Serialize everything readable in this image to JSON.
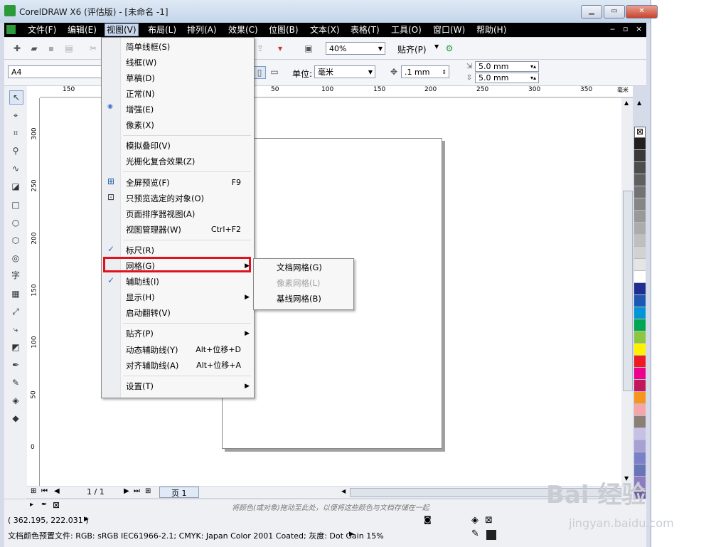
{
  "window": {
    "title": "CorelDRAW X6 (评估版) - [未命名 -1]"
  },
  "menubar": {
    "items": [
      {
        "label": "文件(F)"
      },
      {
        "label": "编辑(E)"
      },
      {
        "label": "视图(V)"
      },
      {
        "label": "布局(L)"
      },
      {
        "label": "排列(A)"
      },
      {
        "label": "效果(C)"
      },
      {
        "label": "位图(B)"
      },
      {
        "label": "文本(X)"
      },
      {
        "label": "表格(T)"
      },
      {
        "label": "工具(O)"
      },
      {
        "label": "窗口(W)"
      },
      {
        "label": "帮助(H)"
      }
    ],
    "active_index": 2
  },
  "toolbar": {
    "zoom": "40%",
    "snap_label": "贴齐(P)"
  },
  "propertybar": {
    "page_size": "A4",
    "unit_label": "单位:",
    "unit_value": "毫米",
    "nudge": ".1 mm",
    "dup_x": "5.0 mm",
    "dup_y": "5.0 mm"
  },
  "ruler": {
    "h_ticks": [
      "150",
      "50",
      "100",
      "150",
      "200",
      "250",
      "300",
      "350"
    ],
    "h_unit": "毫米",
    "v_ticks": [
      "300",
      "250",
      "200",
      "150",
      "100",
      "50",
      "0"
    ]
  },
  "view_menu": {
    "items": [
      {
        "label": "简单线框(S)"
      },
      {
        "label": "线框(W)"
      },
      {
        "label": "草稿(D)"
      },
      {
        "label": "正常(N)"
      },
      {
        "label": "增强(E)"
      },
      {
        "label": "像素(X)"
      },
      {
        "label": "模拟叠印(V)"
      },
      {
        "label": "光栅化复合效果(Z)"
      },
      {
        "label": "全屏预览(F)",
        "shortcut": "F9"
      },
      {
        "label": "只预览选定的对象(O)"
      },
      {
        "label": "页面排序器视图(A)"
      },
      {
        "label": "视图管理器(W)",
        "shortcut": "Ctrl+F2"
      },
      {
        "label": "标尺(R)"
      },
      {
        "label": "网格(G)"
      },
      {
        "label": "辅助线(I)"
      },
      {
        "label": "显示(H)"
      },
      {
        "label": "启动翻转(V)"
      },
      {
        "label": "贴齐(P)"
      },
      {
        "label": "动态辅助线(Y)",
        "shortcut": "Alt+位移+D"
      },
      {
        "label": "对齐辅助线(A)",
        "shortcut": "Alt+位移+A"
      },
      {
        "label": "设置(T)"
      }
    ]
  },
  "grid_submenu": {
    "items": [
      {
        "label": "文档网格(G)",
        "enabled": true
      },
      {
        "label": "像素网格(L)",
        "enabled": false
      },
      {
        "label": "基线网格(B)",
        "enabled": true
      }
    ]
  },
  "pagenav": {
    "counter": "1 / 1",
    "tab": "页 1"
  },
  "hint": "将颜色(或对象)拖动至此处，以便将这些颜色与文档存储在一起",
  "status": {
    "coords": "( 362.195, 222.031 )",
    "color_profile": "文档颜色预置文件: RGB: sRGB IEC61966-2.1; CMYK: Japan Color 2001 Coated; 灰度: Dot Gain 15%"
  },
  "palette": {
    "colors": [
      "#231f20",
      "#3a3a3a",
      "#4d4d4d",
      "#606060",
      "#737373",
      "#868686",
      "#999999",
      "#acacac",
      "#bfbfbf",
      "#d2d2d2",
      "#e5e5e5",
      "#ffffff",
      "#1f2f8f",
      "#1c58b4",
      "#0096d6",
      "#00a651",
      "#8dc63f",
      "#fff200",
      "#ed1c24",
      "#ec008c",
      "#c2185b",
      "#f7941d",
      "#f4a6a8",
      "#8b7e74",
      "#c8bfe7",
      "#a6a0d4",
      "#7b80c8",
      "#6a74b8",
      "#8e7cc3",
      "#6c5b9e",
      "#5c4b7d",
      "#4a5a8a",
      "#0096d6"
    ]
  },
  "watermark": {
    "brand": "Bai 经验",
    "url": "jingyan.baidu.com"
  }
}
